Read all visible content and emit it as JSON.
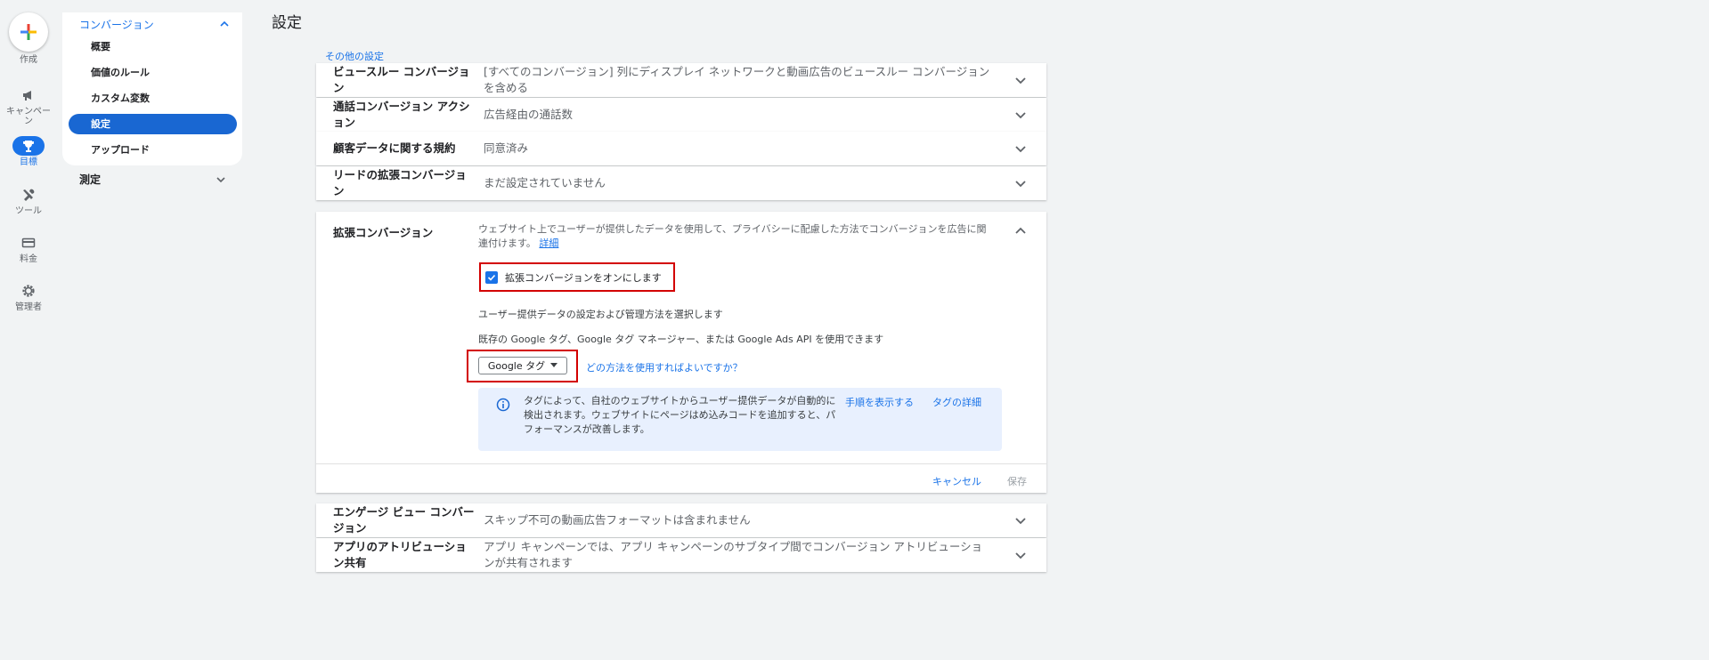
{
  "rail": {
    "create_label": "作成",
    "items": [
      {
        "label": "キャンペーン",
        "icon": "megaphone-icon"
      },
      {
        "label": "目標",
        "icon": "trophy-icon"
      },
      {
        "label": "ツール",
        "icon": "tools-icon"
      },
      {
        "label": "料金",
        "icon": "credit-card-icon"
      },
      {
        "label": "管理者",
        "icon": "gear-icon"
      }
    ]
  },
  "subnav": {
    "section": "コンバージョン",
    "items": [
      "概要",
      "価値のルール",
      "カスタム変数",
      "設定",
      "アップロード"
    ],
    "measure": "測定"
  },
  "page": {
    "title": "設定",
    "other_link": "その他の設定"
  },
  "rows": [
    {
      "label": "ビュースルー コンバージョン",
      "value": "[すべてのコンバージョン] 列にディスプレイ ネットワークと動画広告のビュースルー コンバージョンを含める"
    },
    {
      "label": "通話コンバージョン アクション",
      "value": "広告経由の通話数"
    },
    {
      "label": "顧客データに関する規約",
      "value": "同意済み"
    },
    {
      "label": "リードの拡張コンバージョン",
      "value": "まだ設定されていません"
    }
  ],
  "panel": {
    "title": "拡張コンバージョン",
    "desc": "ウェブサイト上でユーザーが提供したデータを使用して、プライバシーに配慮した方法でコンバージョンを広告に関連付けます。",
    "desc_link": "詳細",
    "checkbox_label": "拡張コンバージョンをオンにします",
    "checkbox_checked": true,
    "select_heading": "ユーザー提供データの設定および管理方法を選択します",
    "select_sub": "既存の Google タグ、Google タグ マネージャー、または Google Ads API を使用できます",
    "method_value": "Google タグ",
    "which_link": "どの方法を使用すればよいですか？",
    "info_text": "タグによって、自社のウェブサイトからユーザー提供データが自動的に検出されます。ウェブサイトにページはめ込みコードを追加すると、パフォーマンスが改善します。",
    "info_link_steps": "手順を表示する",
    "info_link_details": "タグの詳細",
    "cancel": "キャンセル",
    "save": "保存"
  },
  "rows_after": [
    {
      "label": "エンゲージ ビュー コンバージョン",
      "value": "スキップ不可の動画広告フォーマットは含まれません"
    },
    {
      "label": "アプリのアトリビューション共有",
      "value": "アプリ キャンペーンでは、アプリ キャンペーンのサブタイプ間でコンバージョン アトリビューションが共有されます"
    }
  ],
  "colors": {
    "accent": "#1a73e8",
    "highlight": "#d30000",
    "info_bg": "#e8f0fe"
  }
}
